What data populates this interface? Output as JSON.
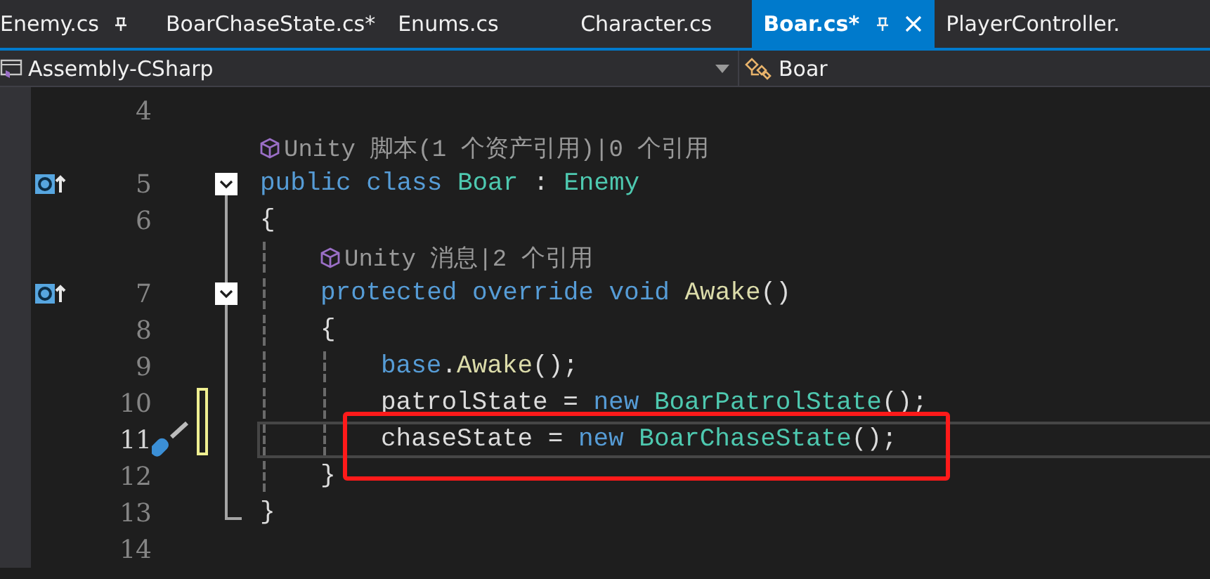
{
  "tabs": [
    {
      "label": "Enemy.cs",
      "selected": false,
      "pinned": true
    },
    {
      "label": "BoarChaseState.cs*",
      "selected": false,
      "pinned": false
    },
    {
      "label": "Enums.cs",
      "selected": false,
      "pinned": false
    },
    {
      "label": "Character.cs",
      "selected": false,
      "pinned": false
    },
    {
      "label": "Boar.cs*",
      "selected": true,
      "pinned": true
    },
    {
      "label": "PlayerController.",
      "selected": false,
      "pinned": false
    }
  ],
  "navigation": {
    "project": "Assembly-CSharp",
    "member": "Boar"
  },
  "lines": [
    {
      "kind": "code",
      "number": "4"
    },
    {
      "kind": "lens",
      "text": "Unity 脚本(1 个资产引用)|0 个引用"
    },
    {
      "kind": "code",
      "number": "5",
      "override": true,
      "expanded": true,
      "tokens": [
        {
          "text": "public class ",
          "kind": "keyword"
        },
        {
          "text": "Boar",
          "kind": "type"
        },
        {
          "text": " : ",
          "kind": "plain"
        },
        {
          "text": "Enemy",
          "kind": "type"
        }
      ]
    },
    {
      "kind": "code",
      "number": "6",
      "tokens": [
        {
          "text": "{",
          "kind": "plain"
        }
      ],
      "children": [
        {
          "kind": "lens",
          "text": "Unity 消息|2 个引用"
        },
        {
          "kind": "code",
          "number": "7",
          "override": true,
          "expanded": true,
          "tokens": [
            {
              "text": "protected override void ",
              "kind": "keyword"
            },
            {
              "text": "Awake",
              "kind": "method"
            },
            {
              "text": "()",
              "kind": "plain"
            }
          ]
        },
        {
          "kind": "code",
          "number": "8",
          "tokens": [
            {
              "text": "{",
              "kind": "plain"
            }
          ],
          "children": [
            {
              "kind": "code",
              "number": "9",
              "tokens": [
                {
                  "text": "base",
                  "kind": "keyword"
                },
                {
                  "text": ".",
                  "kind": "plain"
                },
                {
                  "text": "Awake",
                  "kind": "method"
                },
                {
                  "text": "();",
                  "kind": "plain"
                }
              ]
            },
            {
              "kind": "code",
              "number": "10",
              "changed": true,
              "tokens": [
                {
                  "text": "patrolState = ",
                  "kind": "plain"
                },
                {
                  "text": "new ",
                  "kind": "keyword"
                },
                {
                  "text": "BoarPatrolState",
                  "kind": "type"
                },
                {
                  "text": "();",
                  "kind": "plain"
                }
              ]
            },
            {
              "kind": "code",
              "number": "11",
              "changed": true,
              "current": true,
              "quick_action": true,
              "tokens": [
                {
                  "text": "chaseState = ",
                  "kind": "plain"
                },
                {
                  "text": "new ",
                  "kind": "keyword"
                },
                {
                  "text": "BoarChaseState",
                  "kind": "type"
                },
                {
                  "text": "();",
                  "kind": "plain"
                }
              ]
            }
          ]
        },
        {
          "kind": "code",
          "number": "12",
          "tokens": [
            {
              "text": "}",
              "kind": "plain"
            }
          ]
        }
      ]
    },
    {
      "kind": "code",
      "number": "13",
      "tokens": [
        {
          "text": "}",
          "kind": "plain"
        }
      ]
    },
    {
      "kind": "code",
      "number": "14"
    }
  ]
}
